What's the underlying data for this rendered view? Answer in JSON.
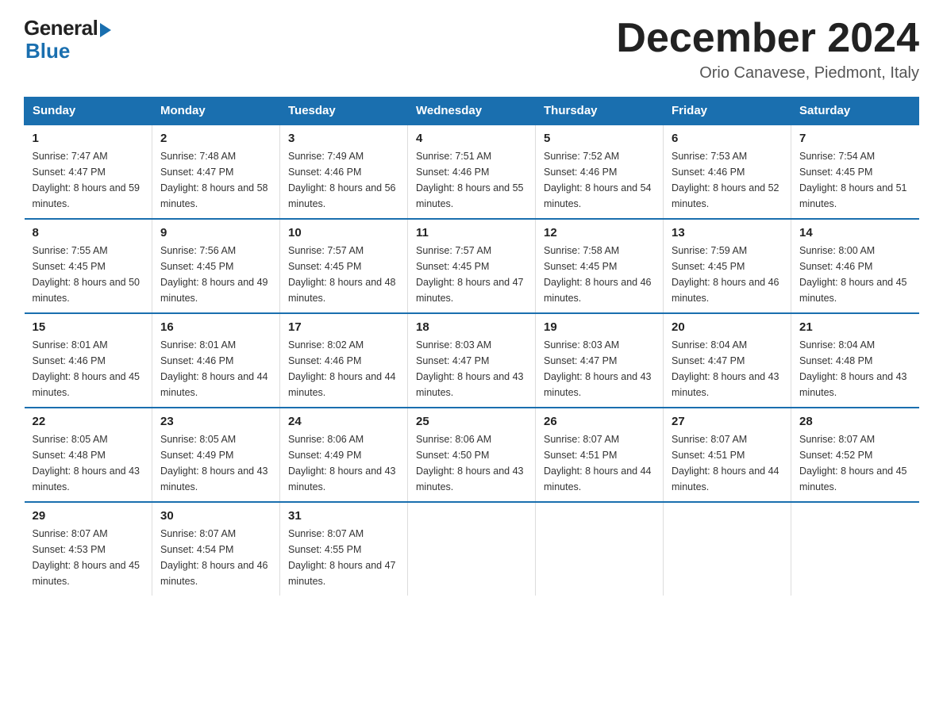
{
  "logo": {
    "general": "General",
    "blue": "Blue"
  },
  "title": {
    "month": "December 2024",
    "location": "Orio Canavese, Piedmont, Italy"
  },
  "headers": [
    "Sunday",
    "Monday",
    "Tuesday",
    "Wednesday",
    "Thursday",
    "Friday",
    "Saturday"
  ],
  "weeks": [
    [
      {
        "day": "1",
        "sunrise": "7:47 AM",
        "sunset": "4:47 PM",
        "daylight": "8 hours and 59 minutes."
      },
      {
        "day": "2",
        "sunrise": "7:48 AM",
        "sunset": "4:47 PM",
        "daylight": "8 hours and 58 minutes."
      },
      {
        "day": "3",
        "sunrise": "7:49 AM",
        "sunset": "4:46 PM",
        "daylight": "8 hours and 56 minutes."
      },
      {
        "day": "4",
        "sunrise": "7:51 AM",
        "sunset": "4:46 PM",
        "daylight": "8 hours and 55 minutes."
      },
      {
        "day": "5",
        "sunrise": "7:52 AM",
        "sunset": "4:46 PM",
        "daylight": "8 hours and 54 minutes."
      },
      {
        "day": "6",
        "sunrise": "7:53 AM",
        "sunset": "4:46 PM",
        "daylight": "8 hours and 52 minutes."
      },
      {
        "day": "7",
        "sunrise": "7:54 AM",
        "sunset": "4:45 PM",
        "daylight": "8 hours and 51 minutes."
      }
    ],
    [
      {
        "day": "8",
        "sunrise": "7:55 AM",
        "sunset": "4:45 PM",
        "daylight": "8 hours and 50 minutes."
      },
      {
        "day": "9",
        "sunrise": "7:56 AM",
        "sunset": "4:45 PM",
        "daylight": "8 hours and 49 minutes."
      },
      {
        "day": "10",
        "sunrise": "7:57 AM",
        "sunset": "4:45 PM",
        "daylight": "8 hours and 48 minutes."
      },
      {
        "day": "11",
        "sunrise": "7:57 AM",
        "sunset": "4:45 PM",
        "daylight": "8 hours and 47 minutes."
      },
      {
        "day": "12",
        "sunrise": "7:58 AM",
        "sunset": "4:45 PM",
        "daylight": "8 hours and 46 minutes."
      },
      {
        "day": "13",
        "sunrise": "7:59 AM",
        "sunset": "4:45 PM",
        "daylight": "8 hours and 46 minutes."
      },
      {
        "day": "14",
        "sunrise": "8:00 AM",
        "sunset": "4:46 PM",
        "daylight": "8 hours and 45 minutes."
      }
    ],
    [
      {
        "day": "15",
        "sunrise": "8:01 AM",
        "sunset": "4:46 PM",
        "daylight": "8 hours and 45 minutes."
      },
      {
        "day": "16",
        "sunrise": "8:01 AM",
        "sunset": "4:46 PM",
        "daylight": "8 hours and 44 minutes."
      },
      {
        "day": "17",
        "sunrise": "8:02 AM",
        "sunset": "4:46 PM",
        "daylight": "8 hours and 44 minutes."
      },
      {
        "day": "18",
        "sunrise": "8:03 AM",
        "sunset": "4:47 PM",
        "daylight": "8 hours and 43 minutes."
      },
      {
        "day": "19",
        "sunrise": "8:03 AM",
        "sunset": "4:47 PM",
        "daylight": "8 hours and 43 minutes."
      },
      {
        "day": "20",
        "sunrise": "8:04 AM",
        "sunset": "4:47 PM",
        "daylight": "8 hours and 43 minutes."
      },
      {
        "day": "21",
        "sunrise": "8:04 AM",
        "sunset": "4:48 PM",
        "daylight": "8 hours and 43 minutes."
      }
    ],
    [
      {
        "day": "22",
        "sunrise": "8:05 AM",
        "sunset": "4:48 PM",
        "daylight": "8 hours and 43 minutes."
      },
      {
        "day": "23",
        "sunrise": "8:05 AM",
        "sunset": "4:49 PM",
        "daylight": "8 hours and 43 minutes."
      },
      {
        "day": "24",
        "sunrise": "8:06 AM",
        "sunset": "4:49 PM",
        "daylight": "8 hours and 43 minutes."
      },
      {
        "day": "25",
        "sunrise": "8:06 AM",
        "sunset": "4:50 PM",
        "daylight": "8 hours and 43 minutes."
      },
      {
        "day": "26",
        "sunrise": "8:07 AM",
        "sunset": "4:51 PM",
        "daylight": "8 hours and 44 minutes."
      },
      {
        "day": "27",
        "sunrise": "8:07 AM",
        "sunset": "4:51 PM",
        "daylight": "8 hours and 44 minutes."
      },
      {
        "day": "28",
        "sunrise": "8:07 AM",
        "sunset": "4:52 PM",
        "daylight": "8 hours and 45 minutes."
      }
    ],
    [
      {
        "day": "29",
        "sunrise": "8:07 AM",
        "sunset": "4:53 PM",
        "daylight": "8 hours and 45 minutes."
      },
      {
        "day": "30",
        "sunrise": "8:07 AM",
        "sunset": "4:54 PM",
        "daylight": "8 hours and 46 minutes."
      },
      {
        "day": "31",
        "sunrise": "8:07 AM",
        "sunset": "4:55 PM",
        "daylight": "8 hours and 47 minutes."
      },
      null,
      null,
      null,
      null
    ]
  ]
}
